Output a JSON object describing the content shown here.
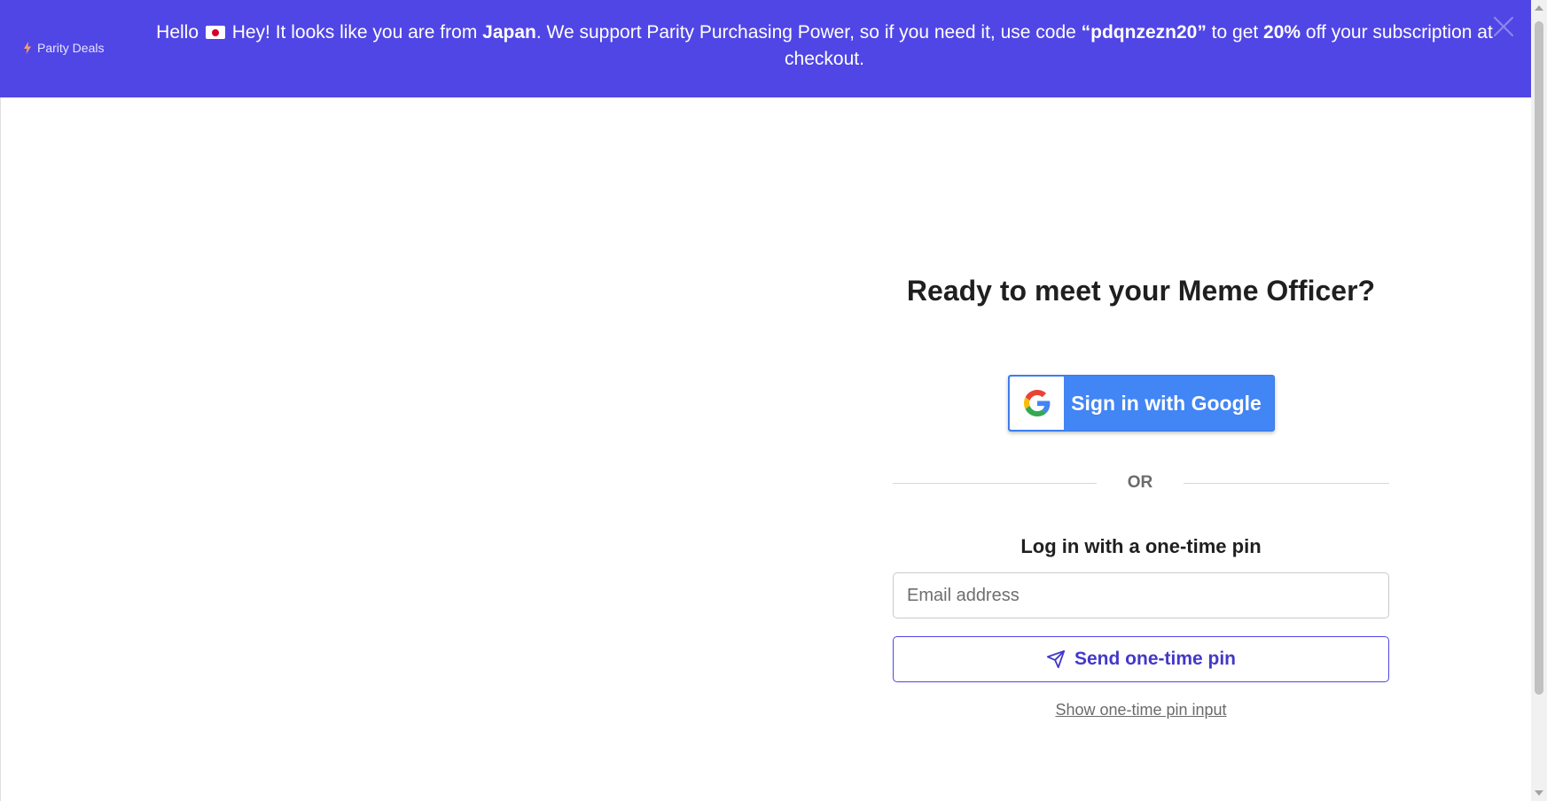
{
  "banner": {
    "brand_name": "Parity Deals",
    "greeting": "Hello",
    "flag_icon": "japan-flag",
    "msg_part1": " Hey! It looks like you are from ",
    "country": "Japan",
    "msg_part2": ". We support Parity Purchasing Power, so if you need it, use code ",
    "code": "“pdqnzezn20”",
    "msg_part3": " to get ",
    "discount": "20%",
    "msg_part4": " off your subscription at checkout.",
    "background_color": "#5046e5",
    "close_icon": "close-icon"
  },
  "login": {
    "title": "Ready to meet your Meme Officer?",
    "google_button_label": "Sign in with Google",
    "google_button_color": "#4285f4",
    "divider_label": "OR",
    "otp_heading": "Log in with a one-time pin",
    "email_placeholder": "Email address",
    "email_value": "",
    "send_button_label": "Send one-time pin",
    "send_button_color": "#4f46e5",
    "send_icon": "paper-plane-icon",
    "show_pin_link": "Show one-time pin input"
  }
}
